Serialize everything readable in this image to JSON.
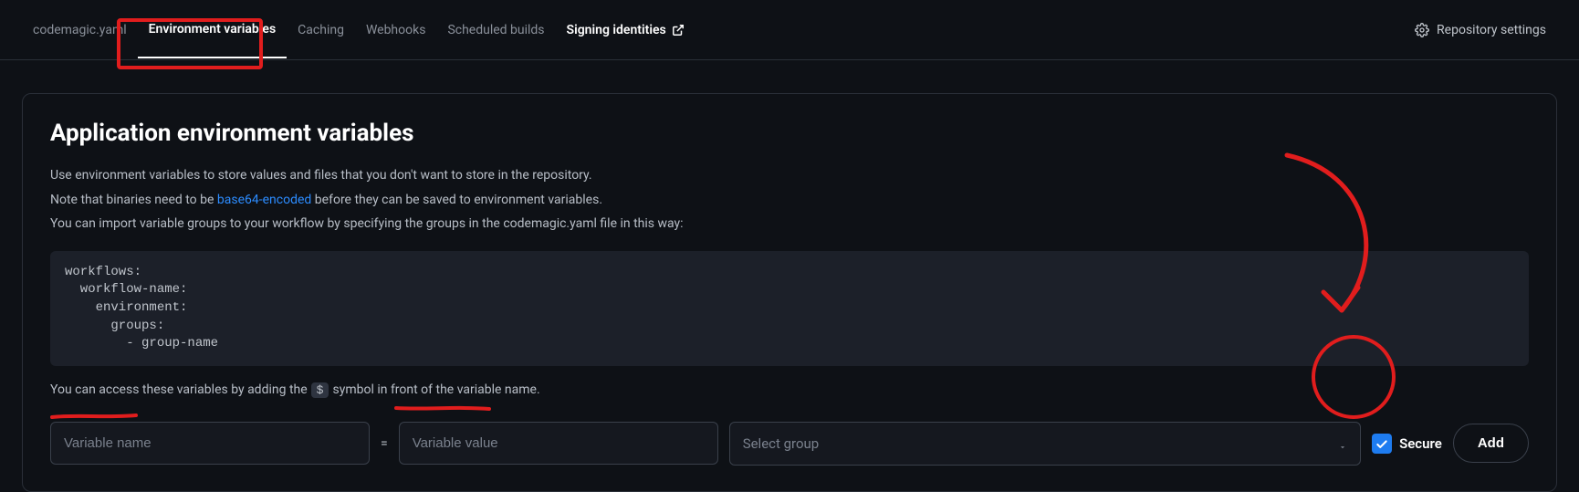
{
  "tabs": {
    "codemagic": "codemagic.yaml",
    "env_vars": "Environment variables",
    "caching": "Caching",
    "webhooks": "Webhooks",
    "scheduled": "Scheduled builds",
    "signing": "Signing identities"
  },
  "repo_settings": "Repository settings",
  "card": {
    "title": "Application environment variables",
    "desc1": "Use environment variables to store values and files that you don't want to store in the repository.",
    "desc2_pre": "Note that binaries need to be ",
    "desc2_link": "base64-encoded",
    "desc2_post": " before they can be saved to environment variables.",
    "desc3": "You can import variable groups to your workflow by specifying the groups in the codemagic.yaml file in this way:",
    "code": "workflows:\n  workflow-name:\n    environment:\n      groups:\n        - group-name",
    "access_pre": "You can access these variables by adding the ",
    "access_dollar": "$",
    "access_post": " symbol in front of the variable name."
  },
  "inputs": {
    "name_placeholder": "Variable name",
    "equals": "=",
    "value_placeholder": "Variable value",
    "select_placeholder": "Select group",
    "secure_label": "Secure",
    "add_label": "Add"
  }
}
